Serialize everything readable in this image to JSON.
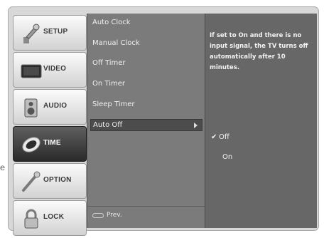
{
  "stray_char": "e",
  "tabs": [
    {
      "name": "setup",
      "label": "SETUP",
      "icon": "setup-wrench-icon",
      "active": false
    },
    {
      "name": "video",
      "label": "VIDEO",
      "icon": "tv-screen-icon",
      "active": false
    },
    {
      "name": "audio",
      "label": "AUDIO",
      "icon": "speaker-icon",
      "active": false
    },
    {
      "name": "time",
      "label": "TIME",
      "icon": "clock-icon",
      "active": true
    },
    {
      "name": "option",
      "label": "OPTION",
      "icon": "option-wand-icon",
      "active": false
    },
    {
      "name": "lock",
      "label": "LOCK",
      "icon": "padlock-icon",
      "active": false
    }
  ],
  "menu": {
    "items": [
      "Auto Clock",
      "Manual Clock",
      "Off Timer",
      "On Timer",
      "Sleep Timer",
      "Auto Off"
    ],
    "selected": "Auto Off",
    "prev_label": "Prev."
  },
  "help_text": "If set to On and there is no input signal, the TV turns off automatically after 10 minutes.",
  "options": {
    "items": [
      "Off",
      "On"
    ],
    "checked": "Off"
  },
  "colors": {
    "active_tab": "#2a2a2a",
    "menu_bg": "#7b7b7b",
    "panel_bg": "#676767"
  }
}
